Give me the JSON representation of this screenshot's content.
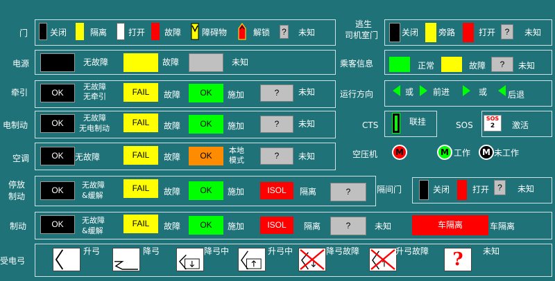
{
  "colors": {
    "background": "#1e7278",
    "black": "#000000",
    "yellow": "#ffff00",
    "green": "#00ff00",
    "red": "#ff0000",
    "grey": "#c0c0c0",
    "orange": "#ff8c00",
    "white": "#ffffff"
  },
  "door": {
    "title": "门",
    "closed": "关闭",
    "isolated": "隔离",
    "open": "打开",
    "fault": "故障",
    "obstacle": "障碍物",
    "locked": "解锁",
    "unknown_q": "?",
    "unknown": "未知"
  },
  "cab_door": {
    "title_line1": "逃生",
    "title_line2": "司机室门",
    "closed": "关闭",
    "bypass": "旁路",
    "open": "打开",
    "unknown_q": "?",
    "unknown": "未知"
  },
  "power": {
    "title": "电源",
    "no_fault": "无故障",
    "fault": "故障",
    "unknown": "未知"
  },
  "passenger_info": {
    "title": "乘客信息",
    "normal": "正常",
    "fault": "故障",
    "unknown_q": "?",
    "unknown": "未知"
  },
  "traction": {
    "title": "牵引",
    "ok": "OK",
    "desc_line1": "无故障",
    "desc_line2": "无牵引",
    "fail": "FAIL",
    "fault": "故障",
    "ok2": "OK",
    "applied": "施加",
    "unknown_q": "?",
    "unknown": "未知"
  },
  "direction": {
    "title": "运行方向",
    "or1": "或",
    "forward": "前进",
    "or2": "或",
    "backward": "后退"
  },
  "elec_brake": {
    "title": "电制动",
    "ok": "OK",
    "desc_line1": "无故障",
    "desc_line2": "无电制动",
    "fail": "FAIL",
    "fault": "故障",
    "ok2": "OK",
    "applied": "施加",
    "unknown_q": "?",
    "unknown": "未知"
  },
  "cts": {
    "title": "CTS",
    "coupled": "联挂"
  },
  "sos": {
    "title": "SOS",
    "icon_text": "SOS",
    "icon_num": "2",
    "active": "激活"
  },
  "hvac": {
    "title": "空调",
    "ok": "OK",
    "no_fault": "无故障",
    "fail": "FAIL",
    "fault": "故障",
    "ok_orange": "OK",
    "local_line1": "本地",
    "local_line2": "模式",
    "unknown_q": "?",
    "unknown": "未知"
  },
  "compressor": {
    "title": "空压机",
    "m1": "M",
    "m2": "M",
    "working": "工作",
    "m3": "M",
    "not_working": "未工作"
  },
  "park_brake": {
    "title_line1": "停放",
    "title_line2": "制动",
    "ok": "OK",
    "desc_line1": "无故障",
    "desc_line2": "&缓解",
    "fail": "FAIL",
    "fault": "故障",
    "ok2": "OK",
    "applied": "施加",
    "isol": "ISOL",
    "isolated": "隔离",
    "unknown_q": "?"
  },
  "partition_door": {
    "title": "隔间门",
    "closed": "关闭",
    "open": "打开",
    "unknown_q": "?",
    "unknown": "未知"
  },
  "brake": {
    "title": "制动",
    "ok": "OK",
    "desc_line1": "无故障",
    "desc_line2": "&缓解",
    "fail": "FAIL",
    "fault": "故障",
    "ok2": "OK",
    "applied": "施加",
    "isol": "ISOL",
    "isolated": "隔离",
    "unknown_q": "?",
    "unknown": "未知",
    "car_isolated_btn": "车隔离",
    "car_isolated": "车隔离"
  },
  "pantograph": {
    "title": "受电弓",
    "raised": "升弓",
    "lowered": "降弓",
    "lowering": "降弓中",
    "raising": "升弓中",
    "lower_fault": "降弓故障",
    "raise_fault": "升弓故障",
    "unknown_q": "?",
    "unknown": "未知"
  }
}
